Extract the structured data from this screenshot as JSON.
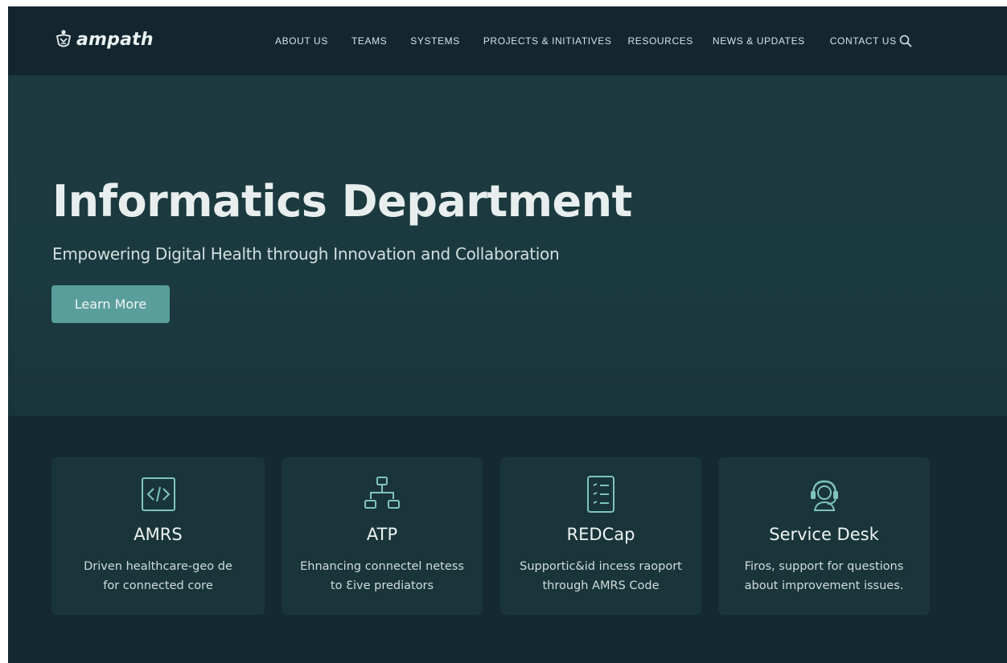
{
  "brand": {
    "name": "ampath"
  },
  "nav": {
    "items": [
      "ABOUT US",
      "TEAMS",
      "SYSTEMS",
      "PROJECTS & INITIATIVES",
      "RESOURCES",
      "NEWS & UPDATES",
      "CONTACT US"
    ],
    "search_icon": "search-icon"
  },
  "hero": {
    "title": "Informatics Department",
    "subtitle": "Empowering Digital Health through Innovation and Collaboration",
    "button_label": "Learn More"
  },
  "cards": [
    {
      "icon": "code-icon",
      "title": "AMRS",
      "description": "Driven healthcare-geo de\nfor connected core"
    },
    {
      "icon": "network-icon",
      "title": "ATP",
      "description": "Ehnancing connectel netess\nto Ɛive prediators"
    },
    {
      "icon": "checklist-icon",
      "title": "REDCap",
      "description": "Supportic&id incess raoport\nthrough AMRS Code"
    },
    {
      "icon": "headset-icon",
      "title": "Service Desk",
      "description": "Firos, support for questions\nabout improvement issues."
    }
  ],
  "colors": {
    "background": "#15282f",
    "hero": "#1c3a3f",
    "accent": "#5a9e9c",
    "card": "#1a3539",
    "icon": "#7fc3c0"
  }
}
